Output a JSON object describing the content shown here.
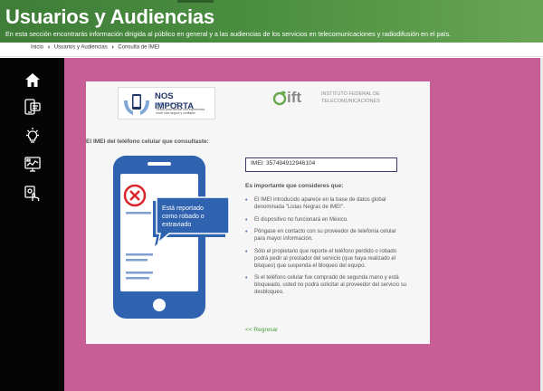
{
  "header": {
    "title": "Usuarios y Audiencias",
    "subtitle": "En esta sección encontrarás información dirigida al público en general y a las audiencias de los servicios en telecomunicaciones y radiodifusión en el país."
  },
  "breadcrumb": {
    "items": [
      "Inicio",
      "Usuarios y Audiencias",
      "Consulta de IMEI"
    ],
    "separator_icon": "chevron-right-icon"
  },
  "sidebar": {
    "icons": [
      "home-icon",
      "phone-id-icon",
      "lightbulb-icon",
      "monitor-chart-icon",
      "device-touch-icon"
    ]
  },
  "logos": {
    "nos_importa": {
      "title": "NOS IMPORTA",
      "subtitle": "MÉXICO",
      "tagline": "Juntos para brindar una experiencia móvil más segura y confiable"
    },
    "ift": {
      "word": "ift",
      "line1": "INSTITUTO FEDERAL DE",
      "line2": "TELECOMUNICACIONES"
    }
  },
  "content": {
    "imei_label": "El IMEI del teléfono celular que consultaste:",
    "imei_value": "IMEI: 357494912946104",
    "phone_message": [
      "Está reportado",
      "como robado o",
      "extraviado"
    ],
    "consider_title": "Es importante que consideres que:",
    "bullets": [
      "El IMEI introducido aparece en la base de datos global denominada \"Listas Negras de IMEI\".",
      "El dispositivo no funcionará en México.",
      "Póngase en contacto con su proveedor de telefonía celular para mayor información.",
      "Sólo el propietario que reporte el teléfono perdido o robado podrá pedir al prestador del servicio (que haya realizado el bloqueo) que suspenda el bloqueo del equipo.",
      "Si el teléfono celular fue comprado de segunda mano y está bloqueado, usted no podrá solicitar al proveedor del servicio su desbloqueo."
    ],
    "back_link": "<< Regresar"
  },
  "colors": {
    "header_green": "#4a8d40",
    "main_pink": "#c75f96",
    "sidebar_black": "#050505",
    "phone_blue": "#2f63b0",
    "alert_red": "#d9252b",
    "link_green": "#4a9a3c"
  }
}
